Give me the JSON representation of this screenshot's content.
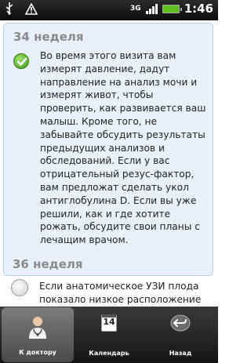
{
  "status_bar": {
    "time": "1:46",
    "network": "3G"
  },
  "week_current": {
    "title": "34 неделя",
    "text": "Во время этого визита вам измерят давление, дадут направление на анализ мочи и измерят живот, чтобы проверить, как развивается ваш малыш. Кроме того, не забывайте обсудить результаты предыдущих анализов и обследований. Если у вас отрицательный резус-фактор, вам предложат сделать укол антиглобулина D. Если вы уже решили, как и где хотите рожать, обсудите свои планы с лечащим врачом.",
    "checked": true
  },
  "week_next": {
    "title": "36 неделя",
    "text": "Если анатомическое УЗИ плода показало низкое расположение плаценты, вам назначат повторное",
    "checked": false
  },
  "tabs": [
    {
      "label": "К доктору",
      "icon": "doctor-icon",
      "active": true
    },
    {
      "label": "Календарь",
      "icon": "calendar-icon",
      "active": false,
      "icon_text": "14"
    },
    {
      "label": "Назад",
      "icon": "back-icon",
      "active": false
    }
  ],
  "colors": {
    "accent_card": "#e8f1fa",
    "check_green": "#5fbf1f",
    "tabbar": "#222222"
  }
}
